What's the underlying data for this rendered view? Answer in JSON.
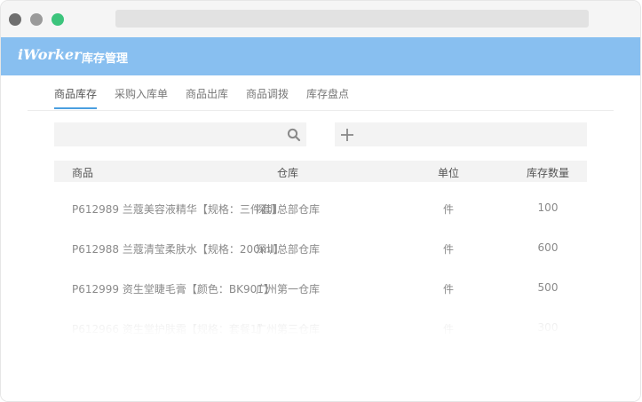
{
  "app": {
    "brand": "iWorker",
    "title": "库存管理"
  },
  "tabs": [
    {
      "label": "商品库存",
      "active": true
    },
    {
      "label": "采购入库单",
      "active": false
    },
    {
      "label": "商品出库",
      "active": false
    },
    {
      "label": "商品调拨",
      "active": false
    },
    {
      "label": "库存盘点",
      "active": false
    }
  ],
  "search": {
    "value": "",
    "placeholder": "",
    "icon": "search-icon"
  },
  "add": {
    "icon": "plus-icon"
  },
  "table": {
    "columns": [
      "商品",
      "仓库",
      "单位",
      "库存数量"
    ],
    "rows": [
      {
        "product": "P612989 兰蔻美容液精华【规格：三件套】",
        "warehouse": "深圳总部仓库",
        "unit": "件",
        "qty": "100"
      },
      {
        "product": "P612988 兰蔻清莹柔肤水【规格：200ml】",
        "warehouse": "深圳总部仓库",
        "unit": "件",
        "qty": "600"
      },
      {
        "product": "P612999 资生堂睫毛膏【颜色：BK901】",
        "warehouse": "广州第一仓库",
        "unit": "件",
        "qty": "500"
      },
      {
        "product": "P612966 资生堂护肤霜【规格：套餐1】",
        "warehouse": "广州第三仓库",
        "unit": "件",
        "qty": "300"
      }
    ]
  },
  "colors": {
    "appbar": "#88bff0",
    "accent": "#4a9fe0",
    "dot_close": "#6f6f6f",
    "dot_min": "#9a9a9a",
    "dot_max": "#3cc47c"
  }
}
